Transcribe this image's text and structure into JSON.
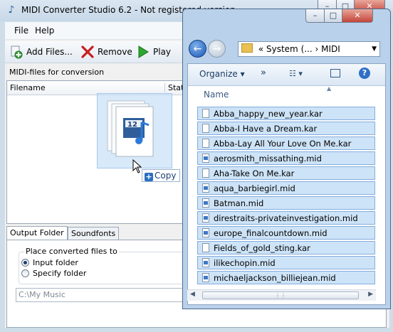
{
  "main": {
    "title": "MIDI Converter Studio 6.2 - Not registered version",
    "menu": [
      "File",
      "Help"
    ],
    "toolbar": {
      "add": "Add Files...",
      "remove": "Remove",
      "play": "Play"
    },
    "list_caption": "MIDI-files for conversion",
    "columns": {
      "filename": "Filename",
      "status": "Status"
    },
    "drag_badge": "12",
    "copy_tooltip": "Copy",
    "tabs": [
      "Output Folder",
      "Soundfonts"
    ],
    "place_label": "Place converted files to",
    "radio_input": "Input folder",
    "radio_specify": "Specify folder",
    "path_value": "C:\\My Music"
  },
  "explorer": {
    "address": {
      "prefix": "«",
      "crumb1": "System (...",
      "sep": "›",
      "crumb2": "MIDI"
    },
    "organize": "Organize ▾",
    "more": "»",
    "column": "Name",
    "files": [
      {
        "name": "Abba_happy_new_year.kar",
        "type": "kar"
      },
      {
        "name": "Abba-I Have a Dream.kar",
        "type": "kar"
      },
      {
        "name": "Abba-Lay All Your Love On Me.kar",
        "type": "kar"
      },
      {
        "name": "aerosmith_missathing.mid",
        "type": "mid"
      },
      {
        "name": "Aha-Take On Me.kar",
        "type": "kar"
      },
      {
        "name": "aqua_barbiegirl.mid",
        "type": "mid"
      },
      {
        "name": "Batman.mid",
        "type": "mid"
      },
      {
        "name": "direstraits-privateinvestigation.mid",
        "type": "mid"
      },
      {
        "name": "europe_finalcountdown.mid",
        "type": "mid"
      },
      {
        "name": "Fields_of_gold_sting.kar",
        "type": "kar"
      },
      {
        "name": "ilikechopin.mid",
        "type": "mid"
      },
      {
        "name": "michaeljackson_billiejean.mid",
        "type": "mid"
      }
    ]
  }
}
